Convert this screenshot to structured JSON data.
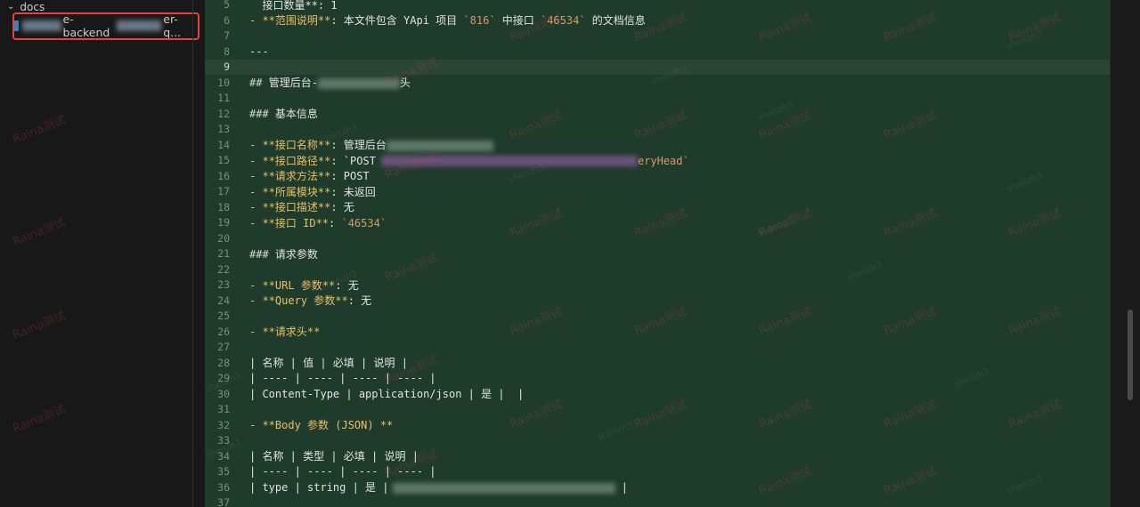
{
  "explorer": {
    "folder_label": "docs",
    "file_name_start": "e-backend",
    "file_name_end": "er-q..."
  },
  "editor": {
    "lines": [
      {
        "n": "5",
        "text": "  接口数量**: 1"
      },
      {
        "n": "6",
        "text": "- **范围说明**: 本文件包含 YApi 项目 `816` 中接口 `46534` 的文档信息"
      },
      {
        "n": "7",
        "text": ""
      },
      {
        "n": "8",
        "text": "---"
      },
      {
        "n": "9",
        "text": ""
      },
      {
        "n": "10",
        "text": "## 管理后台-"
      },
      {
        "n": "11",
        "text": ""
      },
      {
        "n": "12",
        "text": "### 基本信息"
      },
      {
        "n": "13",
        "text": ""
      },
      {
        "n": "14",
        "text": "- **接口名称**: 管理后台"
      },
      {
        "n": "15",
        "text": "- **接口路径**: `POST"
      },
      {
        "n": "16",
        "text": "- **请求方法**: POST"
      },
      {
        "n": "17",
        "text": "- **所属模块**: 未返回"
      },
      {
        "n": "18",
        "text": "- **接口描述**: 无"
      },
      {
        "n": "19",
        "text": "- **接口 ID**: `46534`"
      },
      {
        "n": "20",
        "text": ""
      },
      {
        "n": "21",
        "text": "### 请求参数"
      },
      {
        "n": "22",
        "text": ""
      },
      {
        "n": "23",
        "text": "- **URL 参数**: 无"
      },
      {
        "n": "24",
        "text": "- **Query 参数**: 无"
      },
      {
        "n": "25",
        "text": ""
      },
      {
        "n": "26",
        "text": "- **请求头**"
      },
      {
        "n": "27",
        "text": ""
      },
      {
        "n": "28",
        "text": "| 名称 | 值 | 必填 | 说明 |"
      },
      {
        "n": "29",
        "text": "| ---- | ---- | ---- | ---- |"
      },
      {
        "n": "30",
        "text": "| Content-Type | application/json | 是 |  |"
      },
      {
        "n": "31",
        "text": ""
      },
      {
        "n": "32",
        "text": "- **Body 参数 (JSON) **"
      },
      {
        "n": "33",
        "text": ""
      },
      {
        "n": "34",
        "text": "| 名称 | 类型 | 必填 | 说明 |"
      },
      {
        "n": "35",
        "text": "| ---- | ---- | ---- | ---- |"
      },
      {
        "n": "36",
        "text": "| type | string | 是 |"
      },
      {
        "n": "37",
        "text": ""
      }
    ],
    "line10_tail": "头",
    "line15_tail": "eryHead`",
    "line36_tail": "|"
  },
  "watermarks": {
    "primary": "Raina测试",
    "secondary": "shenzh3"
  },
  "colors": {
    "editor_bg": "#1f3b2b",
    "keyword": "#e8c066",
    "highlight_box": "#e4433f"
  }
}
